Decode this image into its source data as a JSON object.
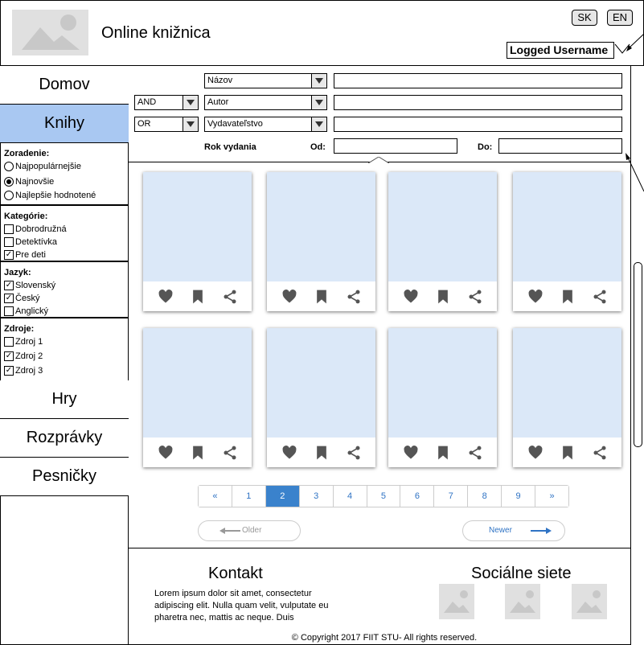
{
  "header": {
    "title": "Online knižnica",
    "lang_sk": "SK",
    "lang_en": "EN",
    "username": "Logged Username"
  },
  "sidebar": {
    "nav_top": [
      "Domov",
      "Knihy"
    ],
    "active": "Knihy",
    "sorting": {
      "title": "Zoradenie:",
      "options": [
        "Najpopulárnejšie",
        "Najnovšie",
        "Najlepšie hodnotené"
      ],
      "selected": "Najnovšie"
    },
    "categories": {
      "title": "Kategórie:",
      "items": [
        {
          "label": "Dobrodružná",
          "checked": false
        },
        {
          "label": "Detektívka",
          "checked": false
        },
        {
          "label": "Pre deti",
          "checked": true
        }
      ]
    },
    "language": {
      "title": "Jazyk:",
      "items": [
        {
          "label": "Slovenský",
          "checked": true
        },
        {
          "label": "Český",
          "checked": true
        },
        {
          "label": "Anglický",
          "checked": false
        }
      ]
    },
    "sources": {
      "title": "Zdroje:",
      "items": [
        {
          "label": "Zdroj 1",
          "checked": false
        },
        {
          "label": "Zdroj 2",
          "checked": true
        },
        {
          "label": "Zdroj 3",
          "checked": true
        }
      ]
    },
    "nav_bottom": [
      "Hry",
      "Rozprávky",
      "Pesničky"
    ]
  },
  "search": {
    "field1": "Názov",
    "op2": "AND",
    "field2": "Autor",
    "op3": "OR",
    "field3": "Vydavateľstvo",
    "year_label": "Rok vydania",
    "from_label": "Od:",
    "to_label": "Do:"
  },
  "pagination": {
    "pages": [
      "«",
      "1",
      "2",
      "3",
      "4",
      "5",
      "6",
      "7",
      "8",
      "9",
      "»"
    ],
    "current": "2",
    "older": "Older",
    "newer": "Newer"
  },
  "footer": {
    "contact_title": "Kontakt",
    "contact_text": "Lorem ipsum dolor sit amet, consectetur adipiscing elit. Nulla quam velit, vulputate eu pharetra nec, mattis ac neque. Duis",
    "social_title": "Sociálne siete",
    "copyright": "© Copyright 2017 FIIT STU- All rights reserved."
  },
  "colors": {
    "active_nav": "#a9c8f2",
    "card_image": "#dbe8f8",
    "page_active": "#3a82cc",
    "link_blue": "#2f73c4"
  },
  "icons": [
    "heart-icon",
    "bookmark-icon",
    "share-icon",
    "image-placeholder-icon",
    "arrow-left-icon",
    "arrow-right-icon"
  ]
}
